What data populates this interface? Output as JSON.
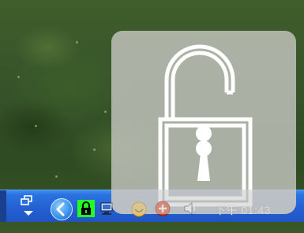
{
  "desktop": {
    "wallpaper": "green-grass"
  },
  "lock_overlay": {
    "icon": "unlocked-padlock-icon",
    "state": "unlocked"
  },
  "taskbar": {
    "desktops_icon": "virtual-desktops-icon",
    "show_hidden_icon": "chevron-left-icon",
    "tray_icons": [
      "padlock-icon",
      "network-computer-icon",
      "messenger-icon",
      "antivirus-icon",
      "volume-icon"
    ],
    "clock": "下午 01:43"
  },
  "colors": {
    "taskbar": "#245fd2",
    "lock_highlight": "#22ff22",
    "overlay": "#c8c8c3"
  }
}
